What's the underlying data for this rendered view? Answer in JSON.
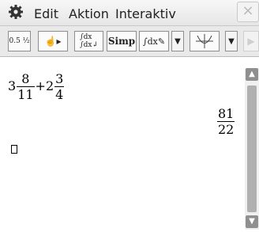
{
  "menubar": {
    "items": [
      "Edit",
      "Aktion",
      "Interaktiv"
    ],
    "close_label": "×"
  },
  "toolbar": {
    "buttons": [
      {
        "name": "decimal-fraction-toggle",
        "label": "0.5 1/2"
      },
      {
        "name": "hand-arrow",
        "label": "☝▸"
      },
      {
        "name": "integral-switch",
        "label": "∫dx ∫dx"
      },
      {
        "name": "simp",
        "label": "Simp"
      },
      {
        "name": "integral-pen",
        "label": "∫dx✎"
      },
      {
        "name": "dropdown-1",
        "label": "▼"
      },
      {
        "name": "graph",
        "label": "⊕"
      },
      {
        "name": "dropdown-2",
        "label": "▼"
      },
      {
        "name": "play-disabled",
        "label": "▶"
      }
    ]
  },
  "input_expr": {
    "whole1": "3",
    "num1": "8",
    "den1": "11",
    "plus": "+",
    "whole2": "2",
    "num2": "3",
    "den2": "4"
  },
  "result": {
    "num": "81",
    "den": "22"
  },
  "scrollbar": {
    "up": "▲",
    "down": "▼"
  }
}
